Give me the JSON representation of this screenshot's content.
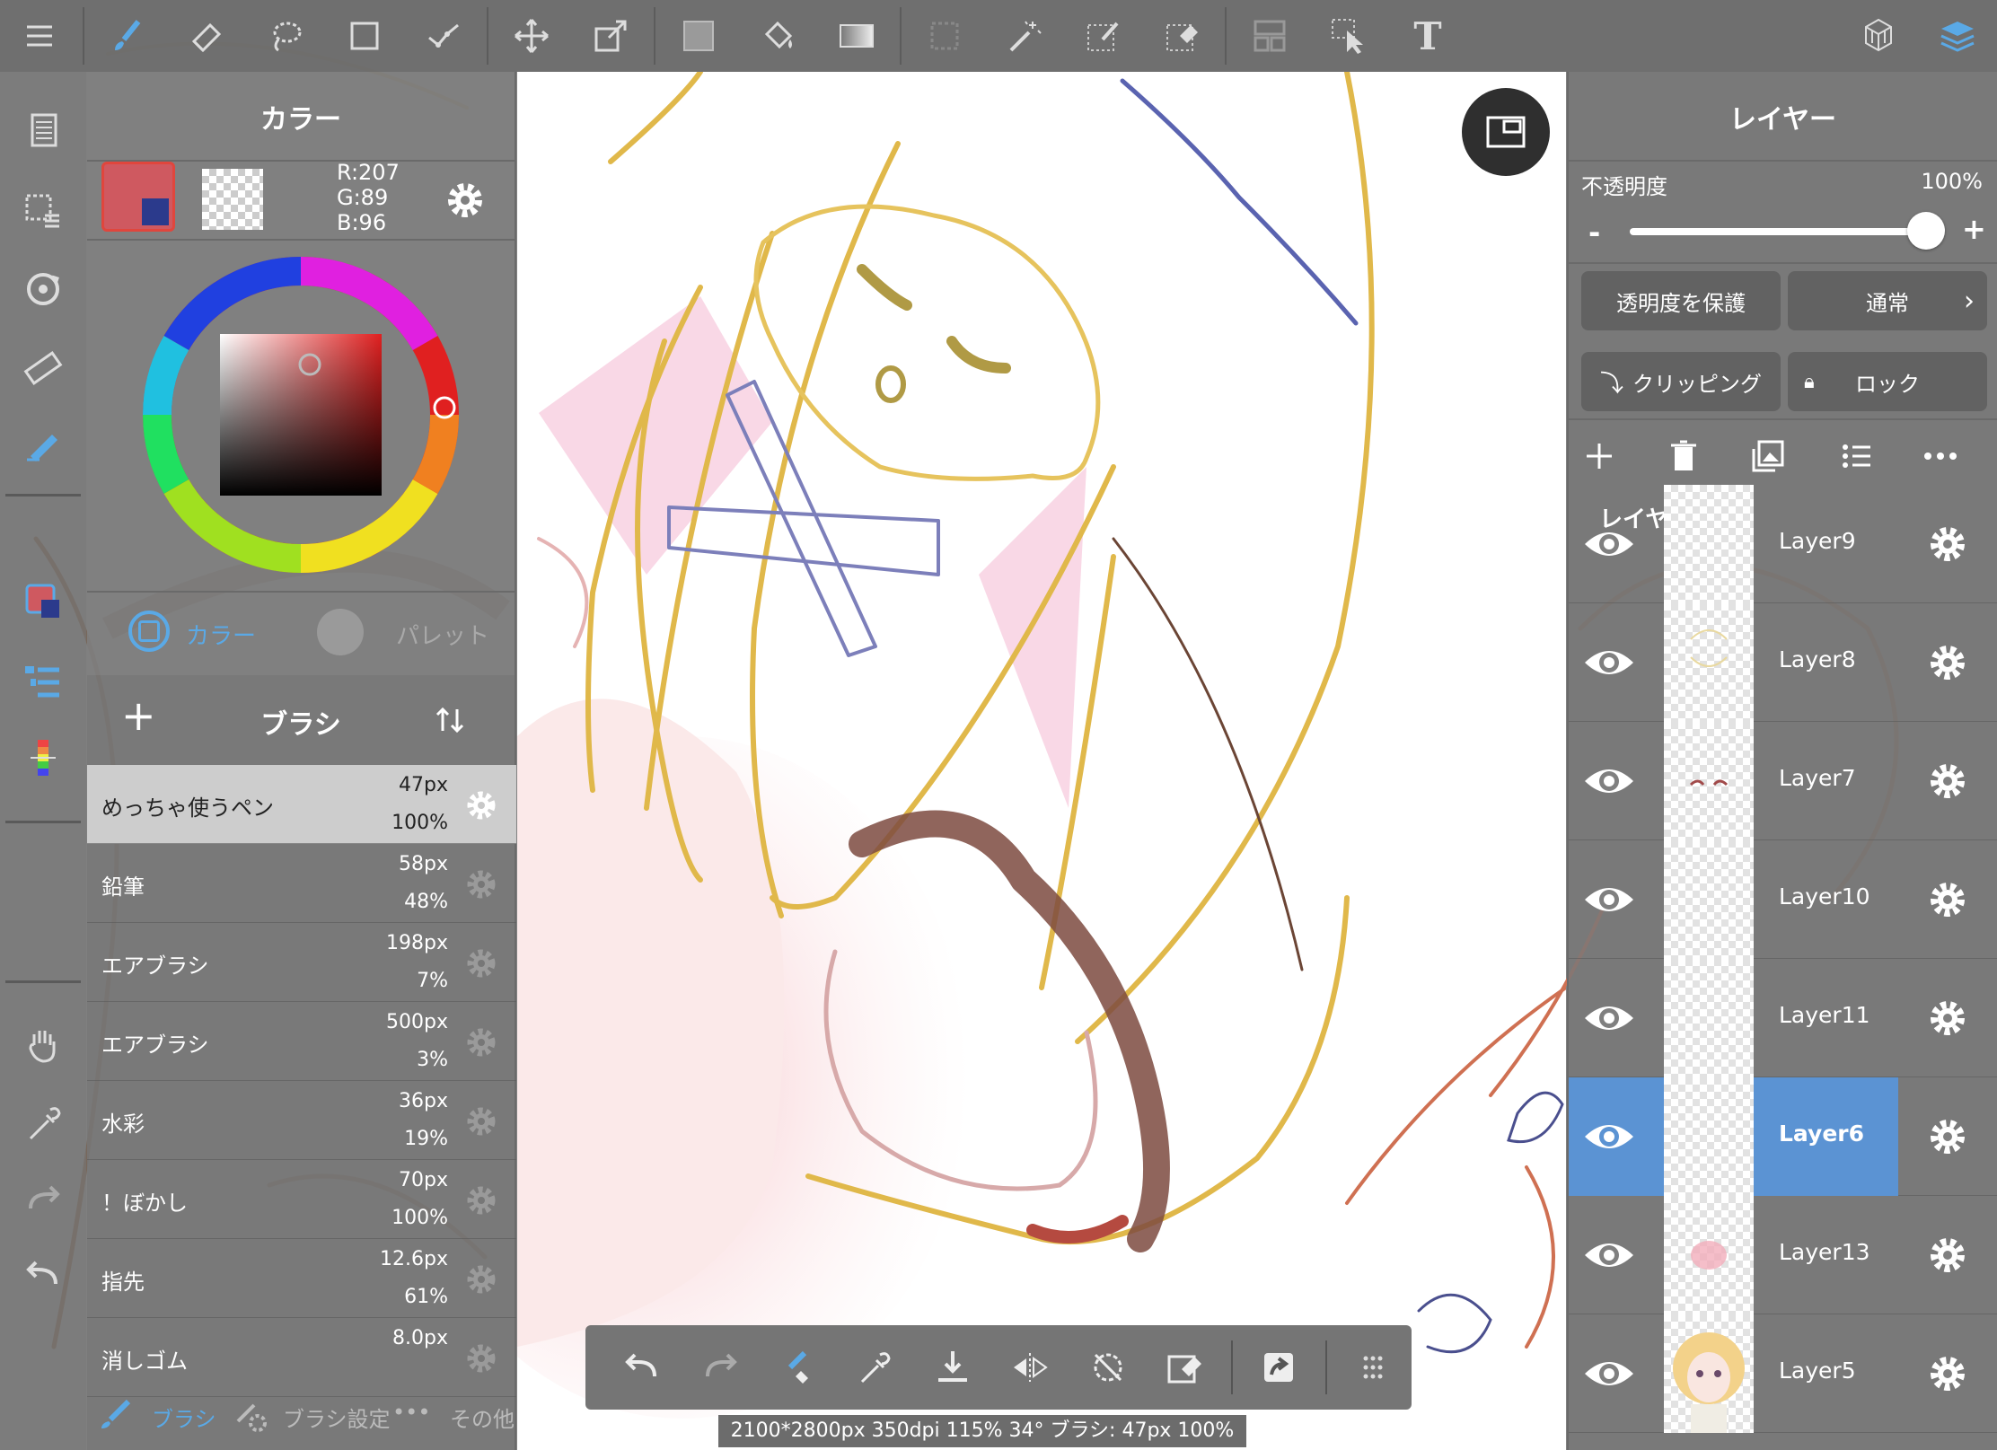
{
  "toolbar": {
    "tools": [
      {
        "name": "menu-icon"
      },
      {
        "name": "brush-tool-icon"
      },
      {
        "name": "eraser-tool-icon"
      },
      {
        "name": "lasso-select-icon"
      },
      {
        "name": "rectangle-shape-icon"
      },
      {
        "name": "pen-path-icon"
      },
      {
        "name": "move-tool-icon"
      },
      {
        "name": "transform-tool-icon"
      },
      {
        "name": "fill-rect-icon"
      },
      {
        "name": "bucket-fill-icon"
      },
      {
        "name": "gradient-icon"
      },
      {
        "name": "select-rect-icon"
      },
      {
        "name": "magic-wand-icon"
      },
      {
        "name": "select-pen-icon"
      },
      {
        "name": "select-eraser-icon"
      },
      {
        "name": "frame-divider-icon"
      },
      {
        "name": "operation-tool-icon"
      },
      {
        "name": "text-tool-icon"
      },
      {
        "name": "3d-material-icon"
      },
      {
        "name": "layers-toggle-icon"
      }
    ],
    "text_tool_glyph": "T"
  },
  "color_panel": {
    "title": "カラー",
    "r_text": "R:207",
    "g_text": "G:89",
    "b_text": "B:96",
    "tab_color": "カラー",
    "tab_palette": "パレット",
    "accent": "#cf5960"
  },
  "brush_panel": {
    "title": "ブラシ",
    "add_symbol": "+",
    "brushes": [
      {
        "name": "めっちゃ使うペン",
        "size": "47px",
        "opacity": "100%"
      },
      {
        "name": "鉛筆",
        "size": "58px",
        "opacity": "48%"
      },
      {
        "name": "エアブラシ",
        "size": "198px",
        "opacity": "7%"
      },
      {
        "name": "エアブラシ",
        "size": "500px",
        "opacity": "3%"
      },
      {
        "name": "水彩",
        "size": "36px",
        "opacity": "19%"
      },
      {
        "name": "！ぼかし",
        "size": "70px",
        "opacity": "100%"
      },
      {
        "name": "指先",
        "size": "12.6px",
        "opacity": "61%"
      },
      {
        "name": "消しゴム",
        "size": "8.0px",
        "opacity": ""
      }
    ],
    "footer_brush": "ブラシ",
    "footer_settings": "ブラシ設定",
    "footer_more_dots": "•••",
    "footer_more": "その他"
  },
  "layer_panel": {
    "title": "レイヤー",
    "opacity_label": "不透明度",
    "opacity_value": "100%",
    "opacity_fraction": 1.0,
    "minus": "-",
    "plus": "+",
    "protect_alpha": "透明度を保護",
    "blend_mode": "通常",
    "clipping": "クリッピング",
    "lock": "ロック",
    "list_title": "レイヤー一覧",
    "layers": [
      {
        "name": "Layer9",
        "selected": false
      },
      {
        "name": "Layer8",
        "selected": false
      },
      {
        "name": "Layer7",
        "selected": false
      },
      {
        "name": "Layer10",
        "selected": false
      },
      {
        "name": "Layer11",
        "selected": false
      },
      {
        "name": "Layer6",
        "selected": true
      },
      {
        "name": "Layer13",
        "selected": false
      },
      {
        "name": "Layer5",
        "selected": false
      }
    ],
    "selected_color": "#5b93d3"
  },
  "status": {
    "text": "2100*2800px 350dpi 115% 34° ブラシ: 47px 100%"
  }
}
